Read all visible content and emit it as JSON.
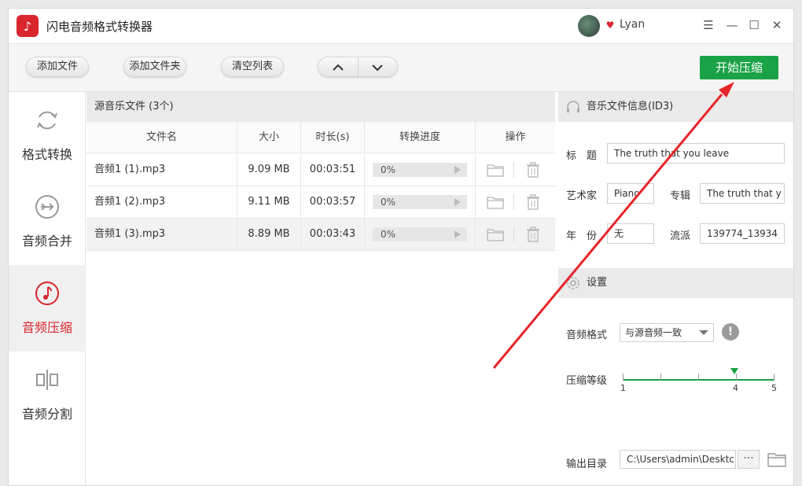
{
  "app": {
    "title": "闪电音频格式转换器",
    "user": "Lyan",
    "logo_icon": "music-note-icon"
  },
  "toolbar": {
    "add_file": "添加文件",
    "add_folder": "添加文件夹",
    "clear_list": "清空列表",
    "move_up": "⌃",
    "move_down": "⌄",
    "start": "开始压缩"
  },
  "sidebar": {
    "items": [
      {
        "label": "格式转换",
        "icon": "refresh-icon"
      },
      {
        "label": "音频合并",
        "icon": "merge-icon"
      },
      {
        "label": "音频压缩",
        "icon": "music-note-icon"
      },
      {
        "label": "音频分割",
        "icon": "split-icon"
      }
    ],
    "active": 2
  },
  "file_list": {
    "title": "源音乐文件 (3个)",
    "columns": [
      "文件名",
      "大小",
      "时长(s)",
      "转换进度",
      "操作"
    ],
    "rows": [
      {
        "name": "音频1 (1).mp3",
        "size": "9.09 MB",
        "duration": "00:03:51",
        "progress": "0%"
      },
      {
        "name": "音频1 (2).mp3",
        "size": "9.11 MB",
        "duration": "00:03:57",
        "progress": "0%"
      },
      {
        "name": "音频1 (3).mp3",
        "size": "8.89 MB",
        "duration": "00:03:43",
        "progress": "0%"
      }
    ]
  },
  "info": {
    "title": "音乐文件信息(ID3)",
    "title_label": "标　题",
    "title_value": "The truth that you leave",
    "artist_label": "艺术家",
    "artist_value": "Piano",
    "album_label": "专辑",
    "album_value": "The truth that y",
    "year_label": "年　份",
    "year_value": "无",
    "genre_label": "流派",
    "genre_value": "139774_13934"
  },
  "settings": {
    "title": "设置",
    "format_label": "音频格式",
    "format_value": "与源音频一致",
    "level_label": "压缩等级",
    "level_min": "1",
    "level_current": "4",
    "level_max": "5",
    "output_label": "输出目录",
    "output_value": "C:\\Users\\admin\\Desktc",
    "more": "···"
  },
  "colors": {
    "accent_green": "#19a246",
    "brand_red": "#d9252c"
  }
}
